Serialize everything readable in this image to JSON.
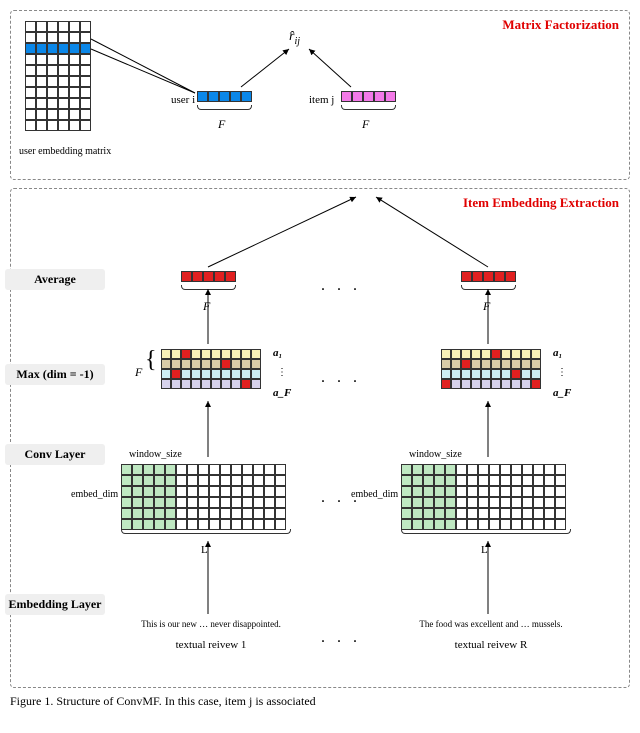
{
  "mf": {
    "title": "Matrix Factorization",
    "user_matrix_label": "user embedding matrix",
    "user_label": "user i",
    "item_label": "item j",
    "F": "F",
    "rhat": "r̂",
    "rhat_sub": "ij"
  },
  "iee": {
    "title": "Item Embedding Extraction",
    "stages": {
      "average": "Average",
      "max": "Max (dim = -1)",
      "conv": "Conv Layer",
      "embedding": "Embedding Layer"
    },
    "F": "F",
    "window_size": "window_size",
    "embed_dim": "embed_dim",
    "L": "L",
    "a1": "a₁",
    "aF": "a_F",
    "vdots": "⋮",
    "dots": ". . .",
    "review1_text": "This is our new … never disappointed.",
    "review1_label": "textual reivew 1",
    "reviewR_text": "The food was excellent and … mussels.",
    "reviewR_label": "textual reivew R"
  },
  "caption": "Figure 1. Structure of ConvMF. In this case, item j is associated"
}
